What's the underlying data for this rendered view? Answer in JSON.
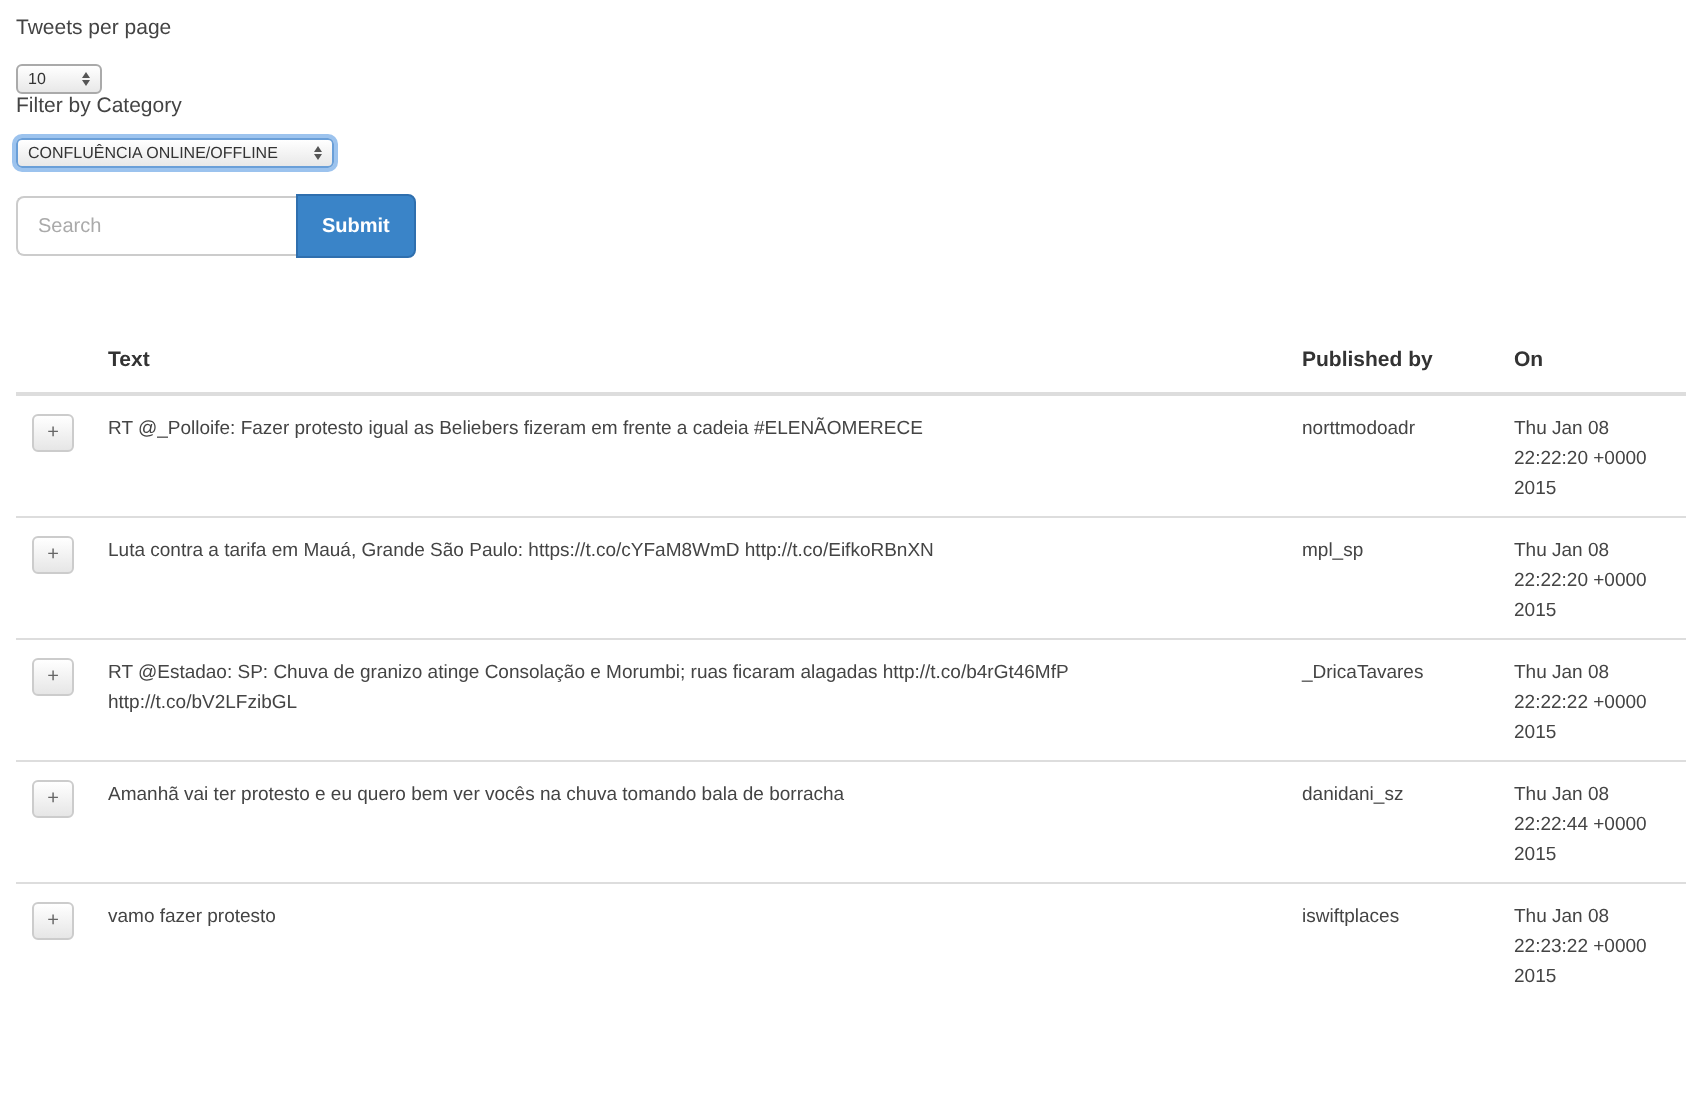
{
  "per_page": {
    "label": "Tweets per page",
    "value": "10"
  },
  "category": {
    "label": "Filter by Category",
    "value": "CONFLUÊNCIA ONLINE/OFFLINE"
  },
  "search": {
    "placeholder": "Search",
    "button": "Submit"
  },
  "table": {
    "columns": [
      "Text",
      "Published by",
      "On"
    ],
    "rows": [
      {
        "expand": "+",
        "text": "RT @_Polloife: Fazer protesto igual as Beliebers fizeram em frente a cadeia #ELENÃOMERECE",
        "author": "norttmodoadr",
        "date": [
          "Thu Jan 08",
          "22:22:20 +0000",
          "2015"
        ]
      },
      {
        "expand": "+",
        "text": "Luta contra a tarifa em Mauá, Grande São Paulo: https://t.co/cYFaM8WmD http://t.co/EifkoRBnXN",
        "author": "mpl_sp",
        "date": [
          "Thu Jan 08",
          "22:22:20 +0000",
          "2015"
        ]
      },
      {
        "expand": "+",
        "text": "RT @Estadao: SP: Chuva de granizo atinge Consolação e Morumbi; ruas ficaram alagadas http://t.co/b4rGt46MfP http://t.co/bV2LFzibGL",
        "author": "_DricaTavares",
        "date": [
          "Thu Jan 08",
          "22:22:22 +0000",
          "2015"
        ]
      },
      {
        "expand": "+",
        "text": "Amanhã vai ter protesto e eu quero bem ver vocês na chuva tomando bala de borracha",
        "author": "danidani_sz",
        "date": [
          "Thu Jan 08",
          "22:22:44 +0000",
          "2015"
        ]
      },
      {
        "expand": "+",
        "text": "vamo fazer protesto",
        "author": "iswiftplaces",
        "date": [
          "Thu Jan 08",
          "22:23:22 +0000",
          "2015"
        ]
      }
    ]
  }
}
